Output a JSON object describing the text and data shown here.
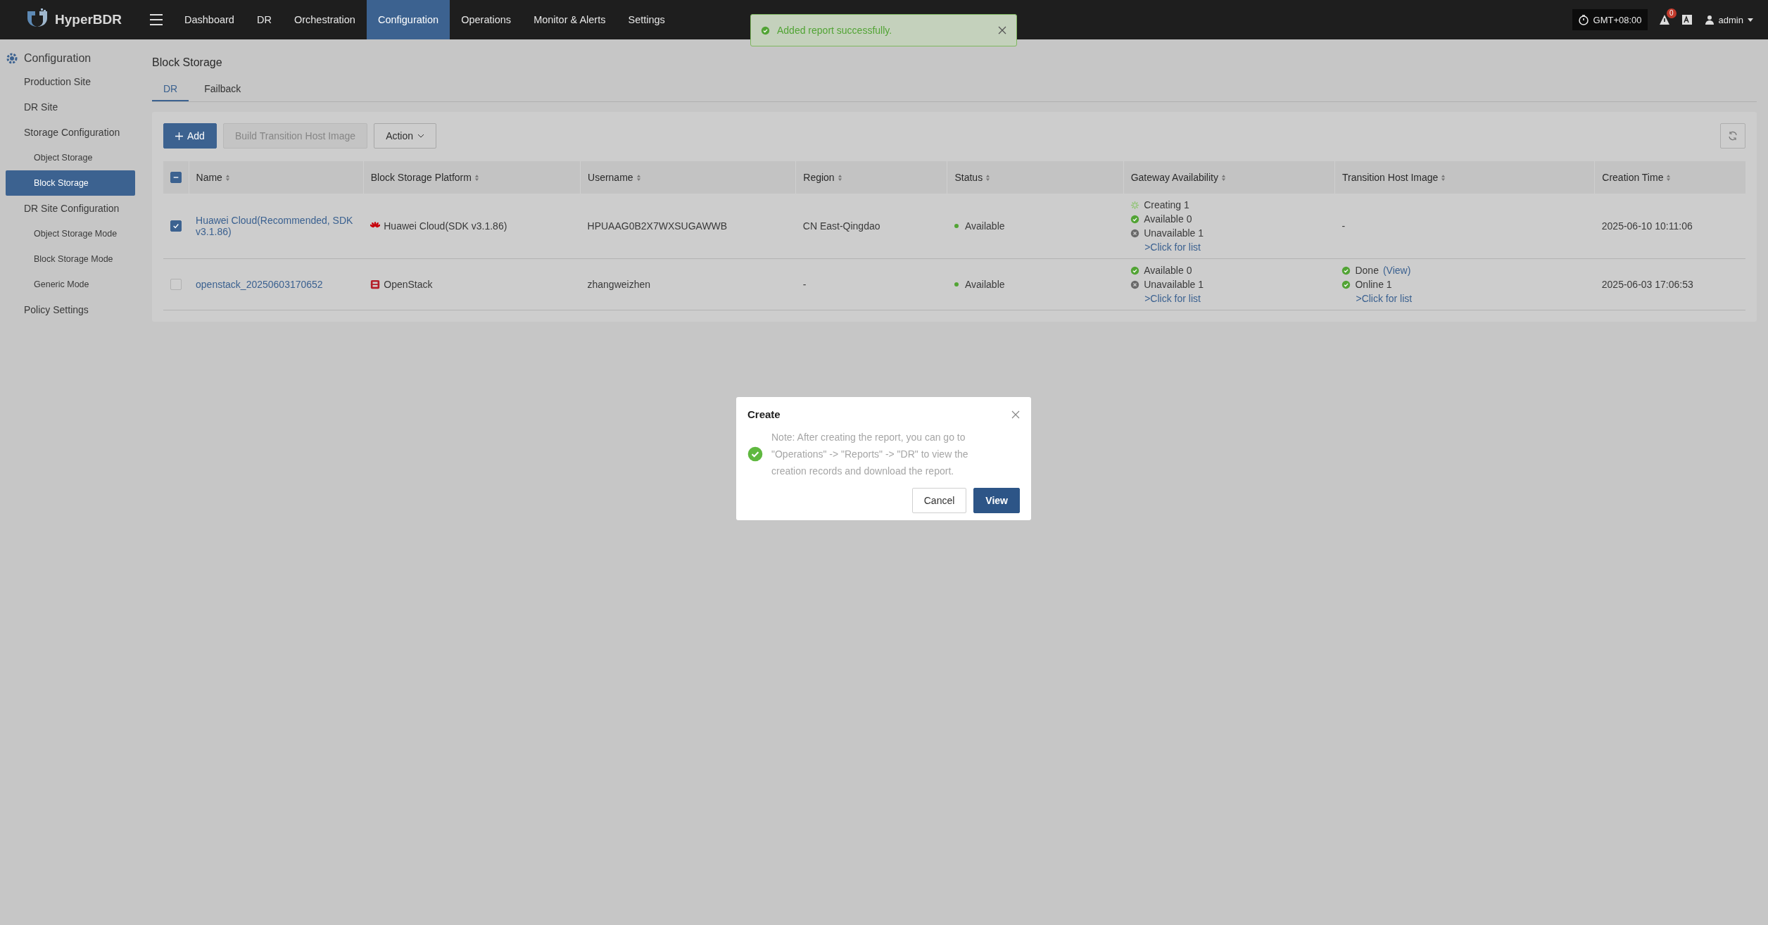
{
  "app": {
    "name": "HyperBDR"
  },
  "nav": [
    {
      "label": "Dashboard",
      "selected": false
    },
    {
      "label": "DR",
      "selected": false
    },
    {
      "label": "Orchestration",
      "selected": false
    },
    {
      "label": "Configuration",
      "selected": true
    },
    {
      "label": "Operations",
      "selected": false
    },
    {
      "label": "Monitor & Alerts",
      "selected": false
    },
    {
      "label": "Settings",
      "selected": false
    }
  ],
  "topbar": {
    "timezone": "GMT+08:00",
    "alert_count": "0",
    "user": "admin"
  },
  "toast": {
    "message": "Added report successfully."
  },
  "sidebar": {
    "title": "Configuration",
    "items": [
      {
        "label": "Production Site",
        "selected": false
      },
      {
        "label": "DR Site",
        "selected": false
      },
      {
        "label": "Storage Configuration",
        "selected": false,
        "children": [
          {
            "label": "Object Storage",
            "selected": false
          },
          {
            "label": "Block Storage",
            "selected": true
          }
        ]
      },
      {
        "label": "DR Site Configuration",
        "selected": false,
        "children": [
          {
            "label": "Object Storage Mode",
            "selected": false
          },
          {
            "label": "Block Storage Mode",
            "selected": false
          },
          {
            "label": "Generic Mode",
            "selected": false
          }
        ]
      },
      {
        "label": "Policy Settings",
        "selected": false
      }
    ]
  },
  "page": {
    "title": "Block Storage",
    "tabs": [
      {
        "label": "DR",
        "selected": true
      },
      {
        "label": "Failback",
        "selected": false
      }
    ]
  },
  "toolbar": {
    "buttons": [
      {
        "label": "Add",
        "kind": "primary",
        "disabled": false
      },
      {
        "label": "Build Transition Host Image",
        "kind": "default",
        "disabled": true
      },
      {
        "label": "Action",
        "kind": "dropdown",
        "disabled": false
      }
    ]
  },
  "table": {
    "select_all": {
      "indeterminate": true
    },
    "columns": [
      "Name",
      "Block Storage Platform",
      "Username",
      "Region",
      "Status",
      "Gateway Availability",
      "Transition Host Image",
      "Creation Time"
    ],
    "rows": [
      {
        "checked": true,
        "name": "Huawei Cloud(Recommended, SDK v3.1.86)",
        "platform": {
          "kind": "huawei",
          "label": "Huawei Cloud(SDK v3.1.86)"
        },
        "username": "HPUAAG0B2X7WXSUGAWWB",
        "region": "CN East-Qingdao",
        "status": {
          "label": "Available",
          "color": "#52a435"
        },
        "gateway": {
          "lines": [
            {
              "kind": "creating",
              "text": "Creating 1"
            },
            {
              "kind": "available",
              "text": "Available 0"
            },
            {
              "kind": "unavailable",
              "text": "Unavailable 1"
            }
          ],
          "link": ">Click for list"
        },
        "transition_image": {
          "text": "-"
        },
        "created": "2025-06-10 10:11:06"
      },
      {
        "checked": false,
        "name": "openstack_20250603170652",
        "platform": {
          "kind": "openstack",
          "label": "OpenStack"
        },
        "username": "zhangweizhen",
        "region": "-",
        "status": {
          "label": "Available",
          "color": "#52a435"
        },
        "gateway": {
          "lines": [
            {
              "kind": "available",
              "text": "Available 0"
            },
            {
              "kind": "unavailable",
              "text": "Unavailable 1"
            }
          ],
          "link": ">Click for list"
        },
        "transition_image": {
          "lines": [
            {
              "kind": "available",
              "text": "Done",
              "link": "(View)"
            },
            {
              "kind": "available",
              "text": "Online 1"
            }
          ],
          "link": ">Click for list"
        },
        "created": "2025-06-03 17:06:53"
      }
    ]
  },
  "dialog": {
    "title": "Create",
    "message": "Note: After creating the report, you can go to \"Operations\" -> \"Reports\" -> \"DR\" to view the creation records and download the report.",
    "buttons": [
      {
        "label": "Cancel",
        "kind": "default"
      },
      {
        "label": "View",
        "kind": "primary"
      }
    ]
  }
}
